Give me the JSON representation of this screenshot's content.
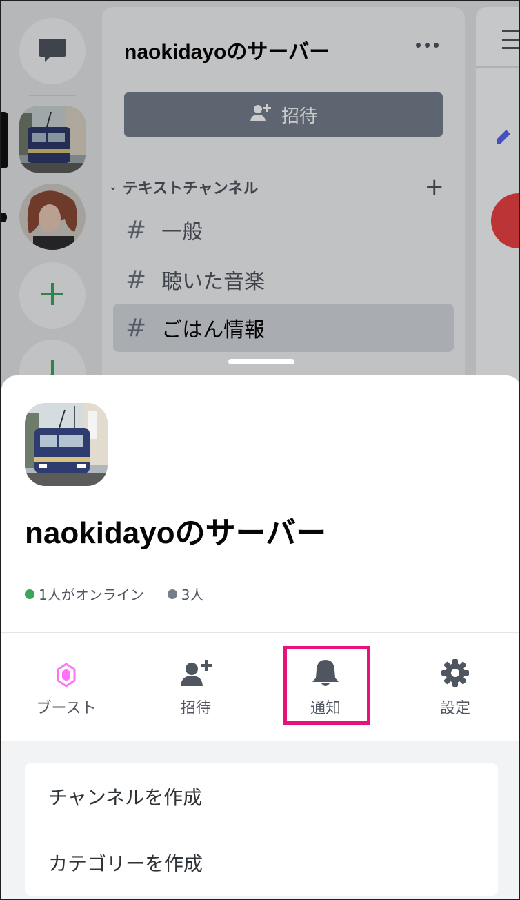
{
  "background": {
    "server_name": "naokidayoのサーバー",
    "invite_label": "招待",
    "category": "テキストチャンネル",
    "channels": [
      {
        "name": "一般"
      },
      {
        "name": "聴いた音楽"
      },
      {
        "name": "ごはん情報",
        "selected": true
      }
    ]
  },
  "sheet": {
    "title": "naokidayoのサーバー",
    "online": "1人がオンライン",
    "members": "3人",
    "online_color": "#3ba55c",
    "members_color": "#747f8d",
    "actions": [
      {
        "label": "ブースト",
        "icon": "boost-icon"
      },
      {
        "label": "招待",
        "icon": "add-user-icon"
      },
      {
        "label": "通知",
        "icon": "bell-icon"
      },
      {
        "label": "設定",
        "icon": "gear-icon"
      }
    ],
    "highlight_color": "#e5137a",
    "menu": [
      {
        "label": "チャンネルを作成"
      },
      {
        "label": "カテゴリーを作成"
      }
    ]
  }
}
